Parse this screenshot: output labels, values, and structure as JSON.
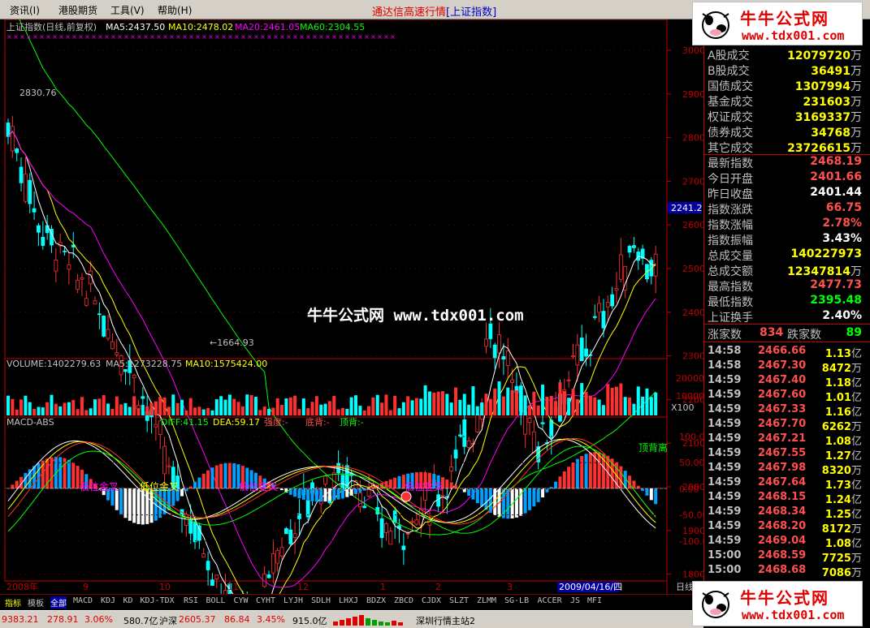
{
  "menu": {
    "items": [
      "资讯(I)",
      "港股期货",
      "工具(V)",
      "帮助(H)"
    ],
    "title": "通达信高速行情",
    "market": "[上证指数]"
  },
  "logo": {
    "title": "牛牛公式网",
    "url": "www.tdx001.com"
  },
  "watermark": "牛牛公式网 www.tdx001.com",
  "main_chart": {
    "legend": [
      "上证指数(日线,前复权)",
      "MA5:2437.50",
      "MA10:2478.02",
      "MA20:2461.05",
      "MA60:2304.55"
    ],
    "high_mark": "2830.76",
    "low_mark": "←1664.93",
    "current_price_tag": "2241.2",
    "y_ticks": [
      "3000",
      "2900",
      "2800",
      "2700",
      "2600",
      "2500",
      "2400",
      "2300",
      "2200",
      "2100",
      "2000",
      "1900",
      "1800"
    ]
  },
  "volume_chart": {
    "legend": [
      "VOLUME:1402279.63",
      "MA5:1273228.75",
      "MA10:1575424.00"
    ],
    "y_ticks": [
      "20000",
      "10000"
    ],
    "unit": "X100"
  },
  "macd_chart": {
    "title": "MACD-ABS",
    "legend": [
      "DIFF:41.15",
      "DEA:59.17",
      "强度:-",
      "底背:-",
      "顶背:-"
    ],
    "y_ticks": [
      "100.0",
      "50.00",
      "0.00",
      "-50.00",
      "-100.0"
    ],
    "annotations": [
      "低位金叉",
      "低位金叉",
      "低位金叉",
      "低位金叉",
      "顶背离"
    ]
  },
  "time_axis": {
    "labels": [
      "2008年",
      "9",
      "10",
      "11",
      "12",
      "1",
      "2",
      "3"
    ],
    "cursor_date": "2009/04/16/四",
    "period": "日线"
  },
  "stats": [
    {
      "label": "A股成交",
      "value": "12079720",
      "unit": "万",
      "color": "#ffff00"
    },
    {
      "label": "B股成交",
      "value": "36491",
      "unit": "万",
      "color": "#ffff00"
    },
    {
      "label": "国债成交",
      "value": "1307994",
      "unit": "万",
      "color": "#ffff00"
    },
    {
      "label": "基金成交",
      "value": "231603",
      "unit": "万",
      "color": "#ffff00"
    },
    {
      "label": "权证成交",
      "value": "3169337",
      "unit": "万",
      "color": "#ffff00"
    },
    {
      "label": "债券成交",
      "value": "34768",
      "unit": "万",
      "color": "#ffff00"
    },
    {
      "label": "其它成交",
      "value": "23726615",
      "unit": "万",
      "color": "#ffff00"
    },
    {
      "label": "最新指数",
      "value": "2468.19",
      "unit": "",
      "color": "#ff5050"
    },
    {
      "label": "今日开盘",
      "value": "2401.66",
      "unit": "",
      "color": "#ff5050"
    },
    {
      "label": "昨日收盘",
      "value": "2401.44",
      "unit": "",
      "color": "#ffffff"
    },
    {
      "label": "指数涨跌",
      "value": "66.75",
      "unit": "",
      "color": "#ff5050"
    },
    {
      "label": "指数涨幅",
      "value": "2.78%",
      "unit": "",
      "color": "#ff5050"
    },
    {
      "label": "指数振幅",
      "value": "3.43%",
      "unit": "",
      "color": "#ffffff"
    },
    {
      "label": "总成交量",
      "value": "140227973",
      "unit": "",
      "color": "#ffff00"
    },
    {
      "label": "总成交额",
      "value": "12347814",
      "unit": "万",
      "color": "#ffff00"
    },
    {
      "label": "最高指数",
      "value": "2477.73",
      "unit": "",
      "color": "#ff5050"
    },
    {
      "label": "最低指数",
      "value": "2395.48",
      "unit": "",
      "color": "#00ff00"
    },
    {
      "label": "上证换手",
      "value": "2.40%",
      "unit": "",
      "color": "#ffffff"
    }
  ],
  "updown": {
    "up_label": "涨家数",
    "up_value": "834",
    "down_label": "跌家数",
    "down_value": "89"
  },
  "ticks": [
    {
      "time": "14:58",
      "price": "2466.66",
      "vol": "1.13",
      "unit": "亿"
    },
    {
      "time": "14:58",
      "price": "2467.30",
      "vol": "8472",
      "unit": "万"
    },
    {
      "time": "14:59",
      "price": "2467.40",
      "vol": "1.18",
      "unit": "亿"
    },
    {
      "time": "14:59",
      "price": "2467.60",
      "vol": "1.01",
      "unit": "亿"
    },
    {
      "time": "14:59",
      "price": "2467.33",
      "vol": "1.16",
      "unit": "亿"
    },
    {
      "time": "14:59",
      "price": "2467.70",
      "vol": "6262",
      "unit": "万"
    },
    {
      "time": "14:59",
      "price": "2467.21",
      "vol": "1.08",
      "unit": "亿"
    },
    {
      "time": "14:59",
      "price": "2467.55",
      "vol": "1.27",
      "unit": "亿"
    },
    {
      "time": "14:59",
      "price": "2467.98",
      "vol": "8320",
      "unit": "万"
    },
    {
      "time": "14:59",
      "price": "2467.64",
      "vol": "1.73",
      "unit": "亿"
    },
    {
      "time": "14:59",
      "price": "2468.15",
      "vol": "1.24",
      "unit": "亿"
    },
    {
      "time": "14:59",
      "price": "2468.34",
      "vol": "1.25",
      "unit": "亿"
    },
    {
      "time": "14:59",
      "price": "2468.20",
      "vol": "8172",
      "unit": "万"
    },
    {
      "time": "14:59",
      "price": "2469.04",
      "vol": "1.08",
      "unit": "亿"
    },
    {
      "time": "15:00",
      "price": "2468.59",
      "vol": "7725",
      "unit": "万"
    },
    {
      "time": "15:00",
      "price": "2468.68",
      "vol": "7086",
      "unit": "万"
    }
  ],
  "tabs": [
    "指标",
    "模板",
    "全部",
    "MACD",
    "KDJ",
    "KD",
    "KDJ-TDX",
    "RSI",
    "BOLL",
    "CYW",
    "CYHT",
    "LYJH",
    "SDLH",
    "LHXJ",
    "BDZX",
    "ZBCD",
    "CJDX",
    "SLZT",
    "ZLMM",
    "SG-LB",
    "ACCER",
    "JS",
    "MFI"
  ],
  "status": {
    "sh_index": "9383.21",
    "sh_change": "278.91",
    "sh_pct": "3.06%",
    "sh_amount": "580.7亿",
    "sz_label": "沪深",
    "sz_index": "2605.37",
    "sz_change": "86.84",
    "sz_pct": "3.45%",
    "sz_amount": "915.0亿",
    "server": "深圳行情主站2"
  },
  "colors": {
    "up": "#ff3030",
    "down": "#00ffff",
    "ma5": "#ffffff",
    "ma10": "#ffff00",
    "ma20": "#ff00ff",
    "ma60": "#00ff00",
    "grid": "#800000"
  }
}
